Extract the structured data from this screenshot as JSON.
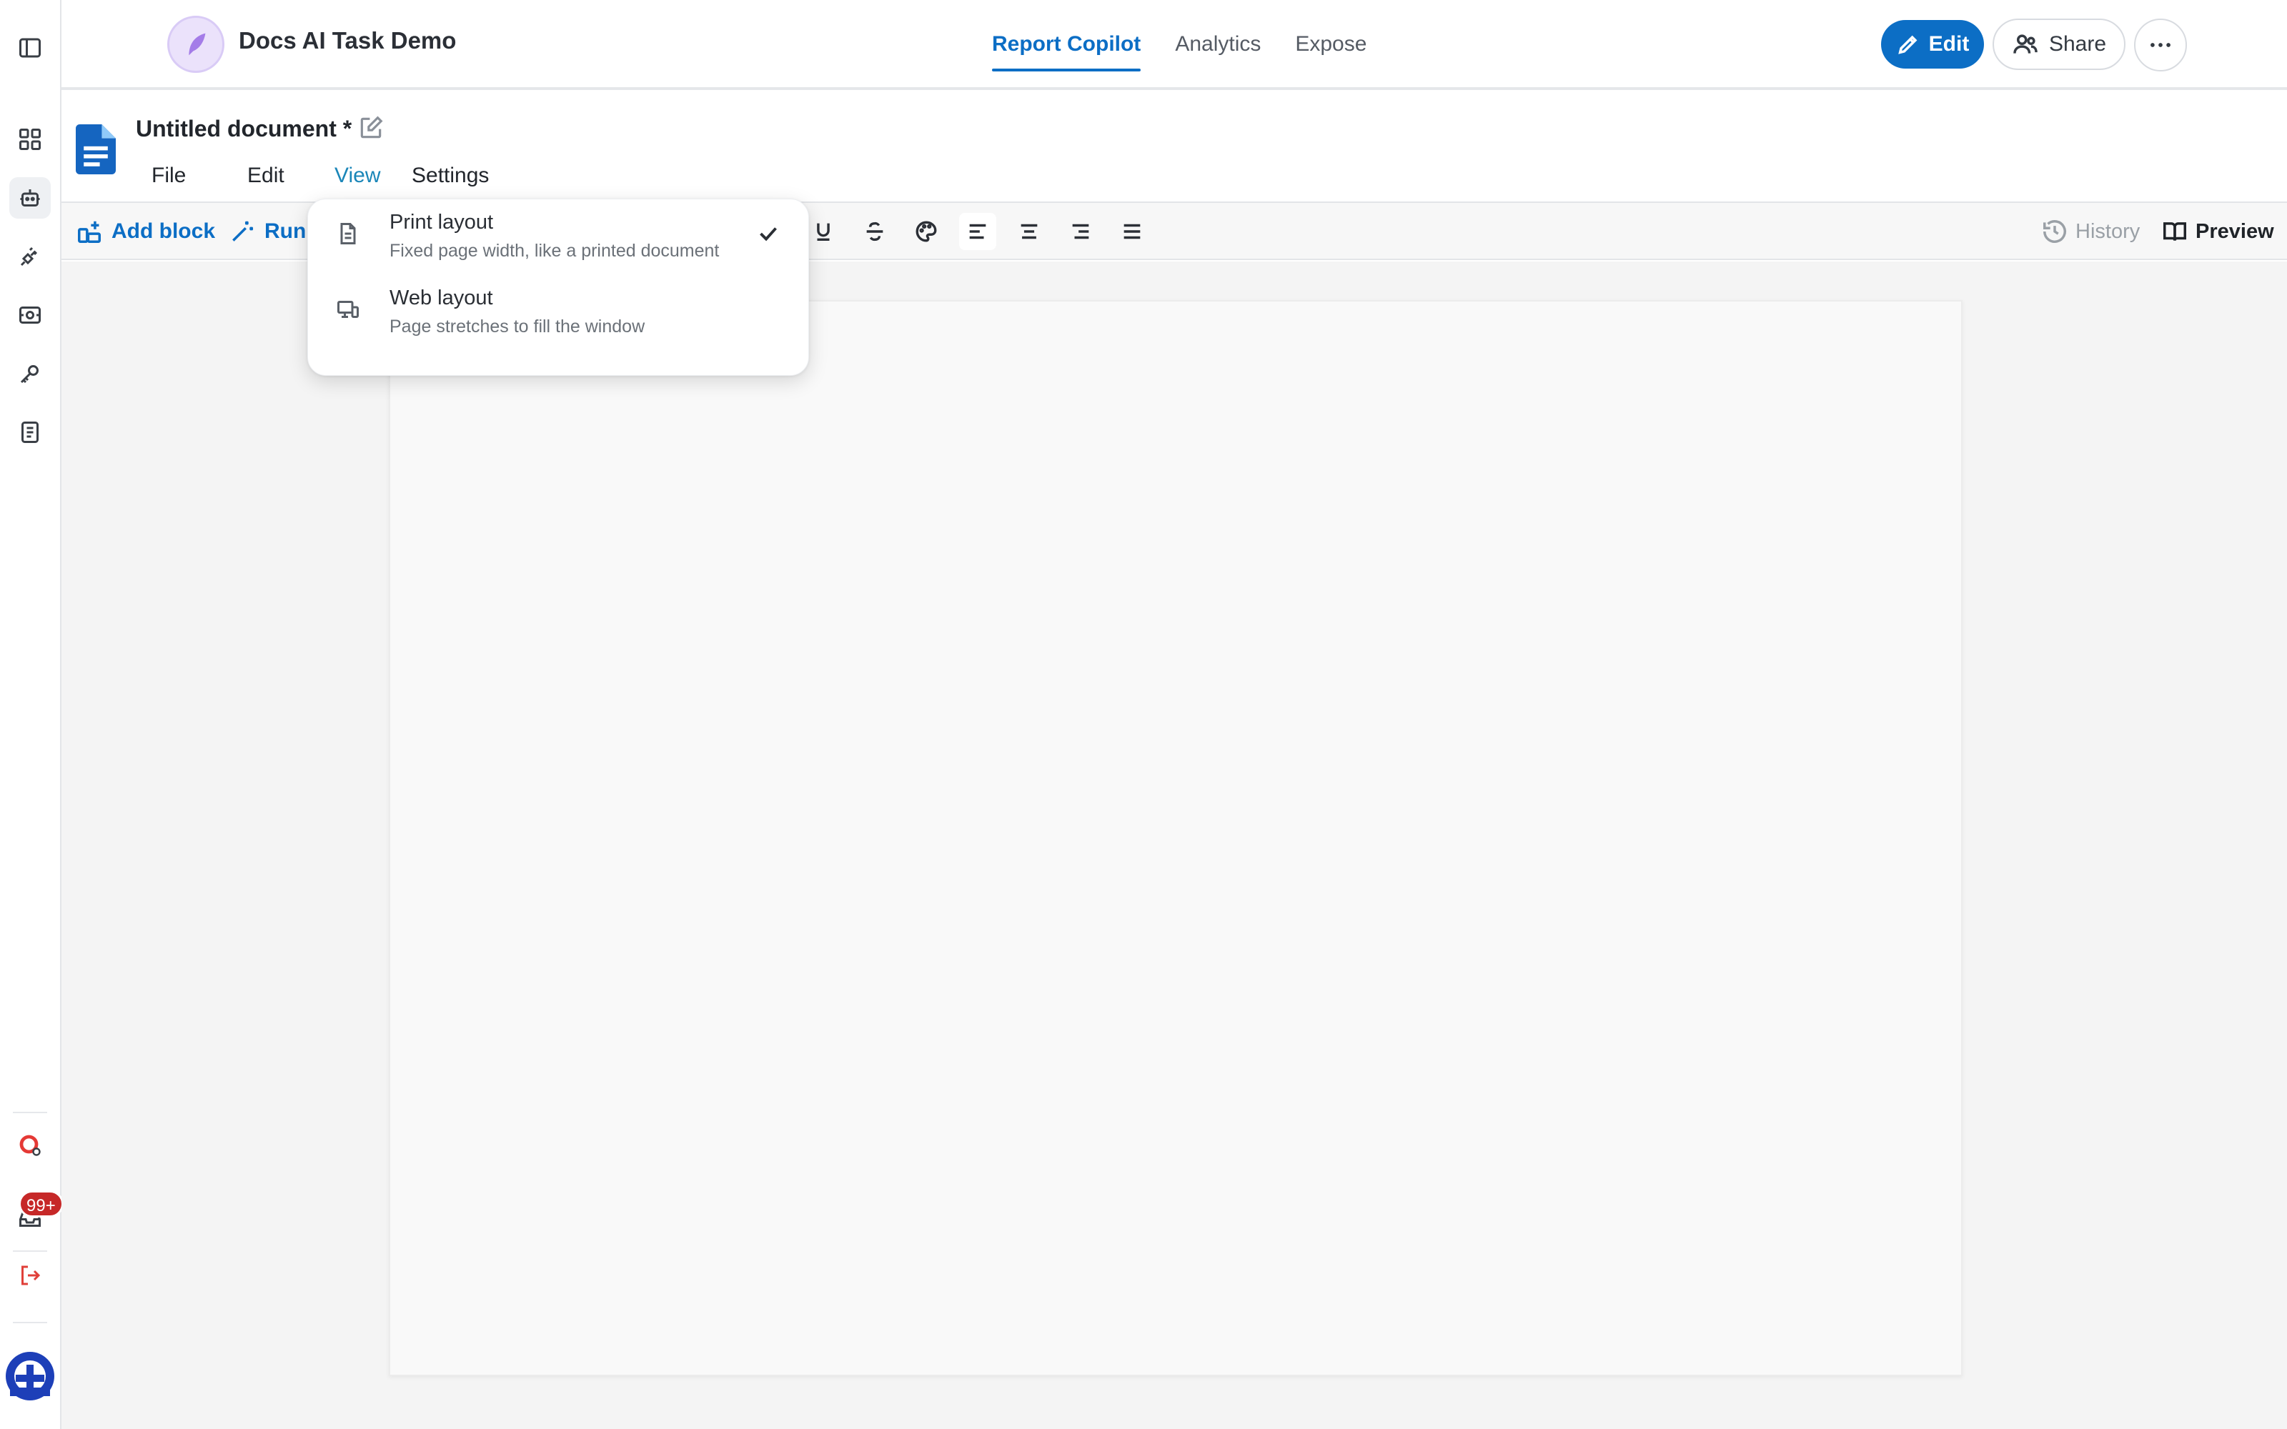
{
  "app": {
    "title": "Docs AI Task Demo",
    "accent_color": "#0c6ec5",
    "logo_icon": "feather-logo"
  },
  "nav_tabs": [
    {
      "label": "Report Copilot",
      "active": true
    },
    {
      "label": "Analytics",
      "active": false
    },
    {
      "label": "Expose",
      "active": false
    }
  ],
  "header_actions": {
    "edit_label": "Edit",
    "share_label": "Share",
    "more_icon": "ellipsis-icon"
  },
  "sidebar": {
    "items": [
      {
        "icon": "panel-toggle-icon"
      },
      {
        "icon": "grid-apps-icon"
      },
      {
        "icon": "robot-icon",
        "active": true
      },
      {
        "icon": "plug-icon"
      },
      {
        "icon": "record-icon"
      },
      {
        "icon": "key-icon"
      },
      {
        "icon": "notebook-icon"
      },
      {
        "icon": "lifebuoy-icon"
      },
      {
        "icon": "inbox-icon"
      },
      {
        "icon": "logout-icon"
      },
      {
        "icon": "avatar"
      }
    ],
    "notification_badge": "99+",
    "badge_color": "#c62828"
  },
  "document": {
    "title": "Untitled document *",
    "menu": [
      {
        "label": "File"
      },
      {
        "label": "Edit"
      },
      {
        "label": "View",
        "open": true
      },
      {
        "label": "Settings"
      }
    ]
  },
  "toolbar": {
    "add_block_label": "Add block",
    "run_label": "Run",
    "history_label": "History",
    "preview_label": "Preview"
  },
  "view_menu": {
    "items": [
      {
        "label": "Print layout",
        "description": "Fixed page width, like a printed document",
        "checked": true,
        "icon": "document-icon"
      },
      {
        "label": "Web layout",
        "description": "Page stretches to fill the window",
        "checked": false,
        "icon": "devices-icon"
      }
    ]
  }
}
